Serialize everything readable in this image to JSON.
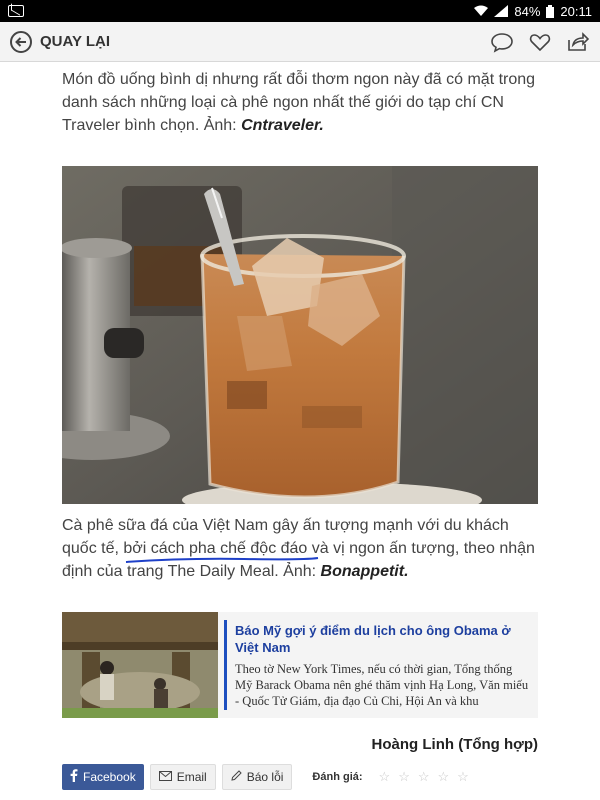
{
  "status_bar": {
    "battery": "84%",
    "time": "20:11"
  },
  "header": {
    "back_label": "QUAY LẠI"
  },
  "article": {
    "para1_text": "Món đồ uống bình dị nhưng rất đỗi thơm ngon này đã có mặt trong danh sách những loại cà phê ngon nhất thế giới do tạp chí CN Traveler bình chọn. Ảnh: ",
    "para1_source": "Cntraveler.",
    "para2_text": "Cà phê sữa đá của Việt Nam gây ấn tượng mạnh với du khách quốc tế, bởi cách pha chế độc đáo và vị ngon ấn tượng, theo nhận định của trang The Daily Meal. Ảnh: ",
    "para2_source": "Bonappetit.",
    "author": "Hoàng Linh (Tổng hợp)"
  },
  "related": {
    "title": "Báo Mỹ gợi ý điểm du lịch cho ông Obama ở Việt Nam",
    "summary": "Theo tờ New York Times, nếu có thời gian, Tổng thống Mỹ Barack Obama nên ghé thăm vịnh Hạ Long, Văn miếu - Quốc Tử Giám, địa đạo Củ Chi, Hội An và khu"
  },
  "actions": {
    "facebook_label": "Facebook",
    "email_label": "Email",
    "report_label": "Báo lỗi",
    "rating_label": "Đánh giá:",
    "stars": [
      "☆",
      "☆",
      "☆",
      "☆",
      "☆"
    ]
  },
  "colors": {
    "facebook": "#3b5998",
    "related_accent": "#1d4fbf",
    "annotation_pen": "#1e40c8"
  }
}
